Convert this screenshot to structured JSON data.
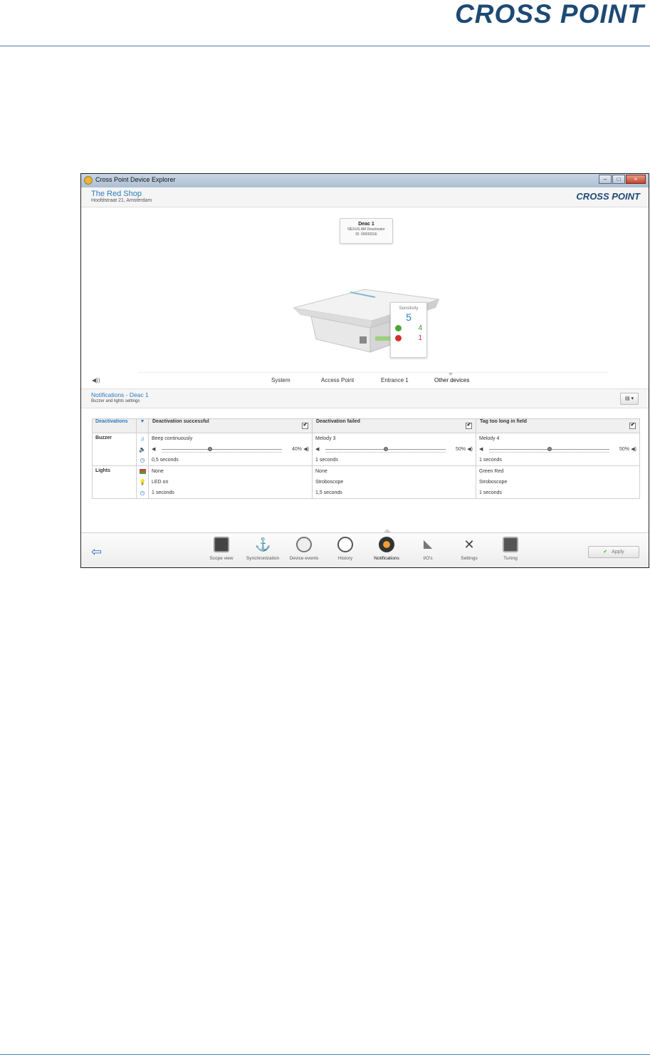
{
  "page": {
    "logo": "CROSS POINT"
  },
  "window": {
    "title": "Cross Point Device Explorer",
    "buttons": [
      "–",
      "□",
      "×"
    ]
  },
  "header": {
    "shop_name": "The Red Shop",
    "address": "Hoofdstraat 21, Amsterdam",
    "logo": "CROSS POINT"
  },
  "device_card": {
    "name": "Deac 1",
    "type": "NEXUS AM Deactivator",
    "id": "ID: 0000001E"
  },
  "sensitivity": {
    "label": "Sensitivity",
    "value": "5",
    "up": "4",
    "down": "1"
  },
  "nav_tabs": [
    "System",
    "Access Point",
    "Entrance 1",
    "Other devices"
  ],
  "notifications": {
    "title": "Notifications - Deac 1",
    "subtitle": "Buzzer and lights settings",
    "menu_icon": "document-icon"
  },
  "table": {
    "first_header": "Deactivations",
    "columns": [
      {
        "header": "Deactivation successful",
        "checked": "✔",
        "buzzer_sound": "Beep continuously",
        "volume_pct": "40%",
        "volume": 0.4,
        "buzzer_duration": "0,5 seconds",
        "light_color": "None",
        "light_mode": "LED on",
        "light_duration": "1 seconds"
      },
      {
        "header": "Deactivation failed",
        "checked": "✔",
        "buzzer_sound": "Melody 3",
        "volume_pct": "50%",
        "volume": 0.5,
        "buzzer_duration": "1 seconds",
        "light_color": "None",
        "light_mode": "Stroboscope",
        "light_duration": "1,5 seconds"
      },
      {
        "header": "Tag too long in field",
        "checked": "✔",
        "buzzer_sound": "Melody 4",
        "volume_pct": "50%",
        "volume": 0.5,
        "buzzer_duration": "1 seconds",
        "light_color": "Green Red",
        "light_mode": "Stroboscope",
        "light_duration": "1 seconds"
      }
    ],
    "rows": {
      "buzzer": "Buzzer",
      "lights": "Lights"
    }
  },
  "toolbar": {
    "items": [
      "Scope view",
      "Synchronization",
      "Device events",
      "History",
      "Notifications",
      "I/O's",
      "Settings",
      "Tuning"
    ],
    "apply": "Apply"
  }
}
